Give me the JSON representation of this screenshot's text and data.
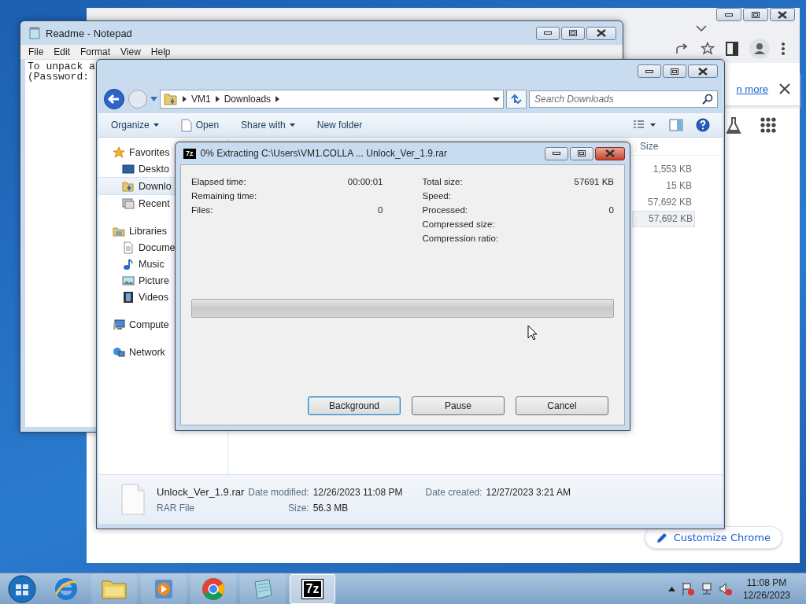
{
  "chrome": {
    "info_link": "n more",
    "customize_button": "Customize Chrome"
  },
  "notepad": {
    "title": "Readme - Notepad",
    "menu": [
      "File",
      "Edit",
      "Format",
      "View",
      "Help"
    ],
    "lines": [
      "To unpack a",
      "(Password:"
    ]
  },
  "explorer": {
    "breadcrumb": [
      "VM1",
      "Downloads"
    ],
    "search": {
      "placeholder": "Search Downloads"
    },
    "toolbar": [
      {
        "label": "Organize",
        "kind": "menu"
      },
      {
        "label": "Open",
        "kind": "file"
      },
      {
        "label": "Share with",
        "kind": "menu"
      },
      {
        "label": "New folder",
        "kind": "plain"
      }
    ],
    "sidebar": [
      {
        "label": "Favorites",
        "children": [
          {
            "label": "Deskto",
            "selected": false
          },
          {
            "label": "Downlo",
            "selected": true
          },
          {
            "label": "Recent",
            "selected": false
          }
        ]
      },
      {
        "label": "Libraries",
        "children": [
          {
            "label": "Docume",
            "selected": false
          },
          {
            "label": "Music",
            "selected": false
          },
          {
            "label": "Picture",
            "selected": false
          },
          {
            "label": "Videos",
            "selected": false
          }
        ]
      },
      {
        "label": "Compute"
      },
      {
        "label": "Network"
      }
    ],
    "columns": [
      {
        "label": "Size"
      }
    ],
    "rows": [
      {
        "size": "1,553 KB",
        "selected": false
      },
      {
        "size": "15 KB",
        "selected": false
      },
      {
        "size": "57,692 KB",
        "selected": false
      },
      {
        "size": "57,692 KB",
        "selected": true
      }
    ],
    "details": {
      "name": "Unlock_Ver_1.9.rar",
      "type": "RAR File",
      "fields": [
        {
          "label": "Date modified:",
          "value": "12/26/2023 11:08 PM"
        },
        {
          "label": "Date created:",
          "value": "12/27/2023 3:21 AM"
        },
        {
          "label": "Size:",
          "value": "56.3 MB"
        }
      ]
    }
  },
  "dialog": {
    "icon_text": "7z",
    "title": "0% Extracting C:\\Users\\VM1.COLLA ... Unlock_Ver_1.9.rar",
    "left_stats": [
      {
        "label": "Elapsed time:",
        "value": "00:00:01"
      },
      {
        "label": "Remaining time:"
      },
      {
        "label": "Files:",
        "value": "0"
      }
    ],
    "right_stats": [
      {
        "label": "Total size:",
        "value": "57691 KB"
      },
      {
        "label": "Speed:"
      },
      {
        "label": "Processed:",
        "value": "0"
      },
      {
        "label": "Compressed size:"
      },
      {
        "label": "Compression ratio:"
      }
    ],
    "progress": {
      "level": 0
    },
    "buttons": [
      {
        "label": "Background",
        "default": true
      },
      {
        "label": "Pause",
        "default": false
      },
      {
        "label": "Cancel",
        "default": false
      }
    ]
  },
  "taskbar": {
    "apps": [
      {
        "kind": "ie",
        "active": false
      },
      {
        "kind": "explorer",
        "active": false
      },
      {
        "kind": "media",
        "active": false
      },
      {
        "kind": "chrome",
        "active": false
      },
      {
        "kind": "notepad",
        "active": false
      },
      {
        "kind": "sevenzip",
        "label": "7z",
        "active": true
      }
    ],
    "clock": {
      "time": "11:08 PM",
      "date": "12/26/2023"
    }
  }
}
